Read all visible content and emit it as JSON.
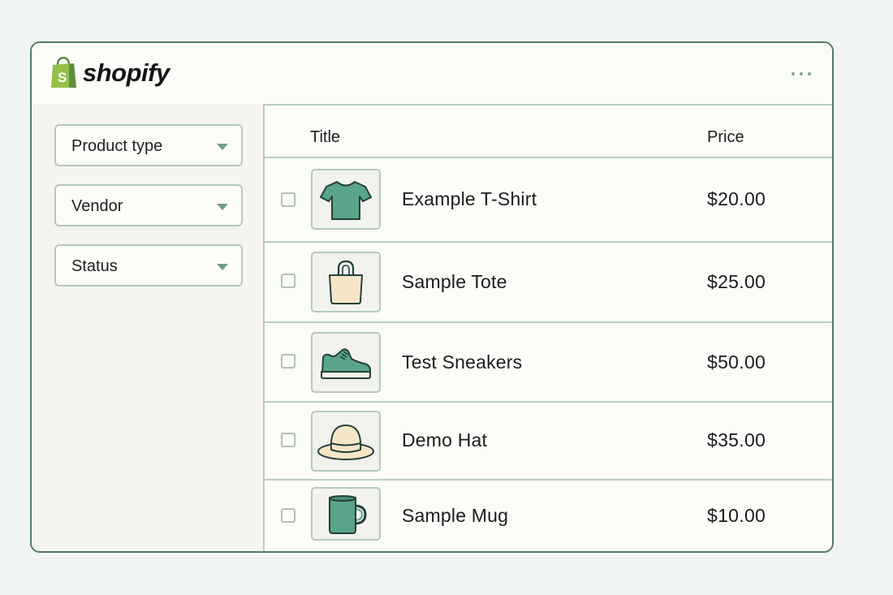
{
  "app": {
    "logo_text": "shopify"
  },
  "filters": [
    {
      "label": "Product type"
    },
    {
      "label": "Vendor"
    },
    {
      "label": "Status"
    }
  ],
  "table": {
    "headers": {
      "title": "Title",
      "price": "Price"
    },
    "rows": [
      {
        "title": "Example T-Shirt",
        "price": "$20.00",
        "icon": "tshirt-icon"
      },
      {
        "title": "Sample Tote",
        "price": "$25.00",
        "icon": "tote-bag-icon"
      },
      {
        "title": "Test Sneakers",
        "price": "$50.00",
        "icon": "sneaker-icon"
      },
      {
        "title": "Demo Hat",
        "price": "$35.00",
        "icon": "hat-icon"
      },
      {
        "title": "Sample Mug",
        "price": "$10.00",
        "icon": "mug-icon"
      }
    ]
  },
  "colors": {
    "accent": "#5aa58a",
    "border": "#4f7a69",
    "shopify_green": "#95bf47",
    "cream": "#f6e6c7"
  }
}
